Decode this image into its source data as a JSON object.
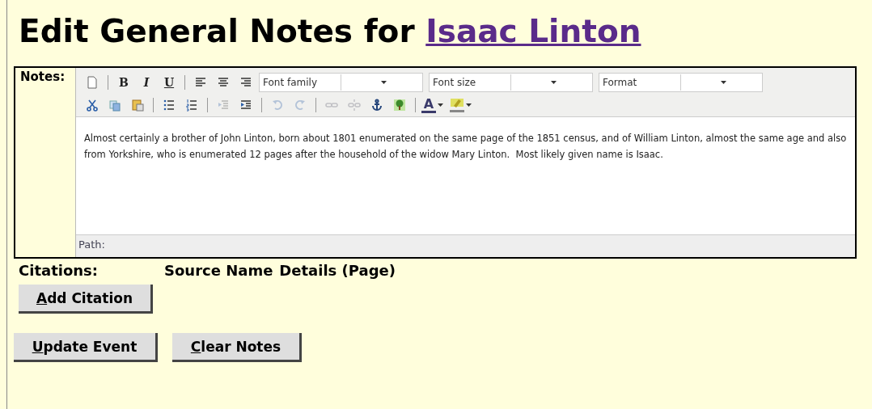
{
  "heading": {
    "text": "Edit General Notes for ",
    "link": "Isaac Linton"
  },
  "notes": {
    "label": "Notes:",
    "toolbar_rows": [
      [
        {
          "kind": "icon",
          "disabled": false
        },
        {
          "kind": "separator"
        },
        {
          "kind": "glyph",
          "label": "B",
          "disabled": false
        },
        {
          "kind": "glyph",
          "label": "I",
          "disabled": false
        },
        {
          "kind": "glyph",
          "label": "U",
          "disabled": false
        },
        {
          "kind": "separator"
        },
        {
          "kind": "icon",
          "disabled": false
        },
        {
          "kind": "icon",
          "disabled": false
        },
        {
          "kind": "icon",
          "disabled": false
        },
        {
          "kind": "select",
          "label": "Font family"
        },
        {
          "kind": "select",
          "label": "Font size"
        },
        {
          "kind": "select",
          "label": "Format"
        }
      ],
      [
        {
          "kind": "icon",
          "disabled": false
        },
        {
          "kind": "icon",
          "disabled": false
        },
        {
          "kind": "icon",
          "disabled": false
        },
        {
          "kind": "separator"
        },
        {
          "kind": "icon",
          "disabled": false
        },
        {
          "kind": "icon",
          "disabled": false
        },
        {
          "kind": "separator"
        },
        {
          "kind": "icon",
          "disabled": true
        },
        {
          "kind": "icon",
          "disabled": false
        },
        {
          "kind": "separator"
        },
        {
          "kind": "icon",
          "disabled": true
        },
        {
          "kind": "icon",
          "disabled": true
        },
        {
          "kind": "separator"
        },
        {
          "kind": "icon",
          "disabled": true
        },
        {
          "kind": "icon",
          "disabled": true
        },
        {
          "kind": "icon",
          "disabled": false
        },
        {
          "kind": "icon",
          "disabled": false
        },
        {
          "kind": "separator"
        },
        {
          "kind": "color-glyph",
          "label": "A",
          "color": "#3a3a6a"
        },
        {
          "kind": "color-icon",
          "color": "#e0e060"
        }
      ]
    ],
    "text": "Almost certainly a brother of John Linton, born about 1801 enumerated on the same page of the 1851 census, and of William Linton, almost the same age and also from Yorkshire, who is enumerated 12 pages after the household of the widow Mary Linton.  Most likely given name is Isaac.",
    "path_label": "Path:"
  },
  "citations": {
    "label": "Citations:",
    "columns": [
      "Source Name",
      "Details (Page)"
    ],
    "button": {
      "access_key": "A",
      "rest": "dd Citation"
    }
  },
  "buttons": [
    {
      "access_key": "U",
      "rest": "pdate Event"
    },
    {
      "access_key": "C",
      "rest": "lear Notes"
    }
  ]
}
